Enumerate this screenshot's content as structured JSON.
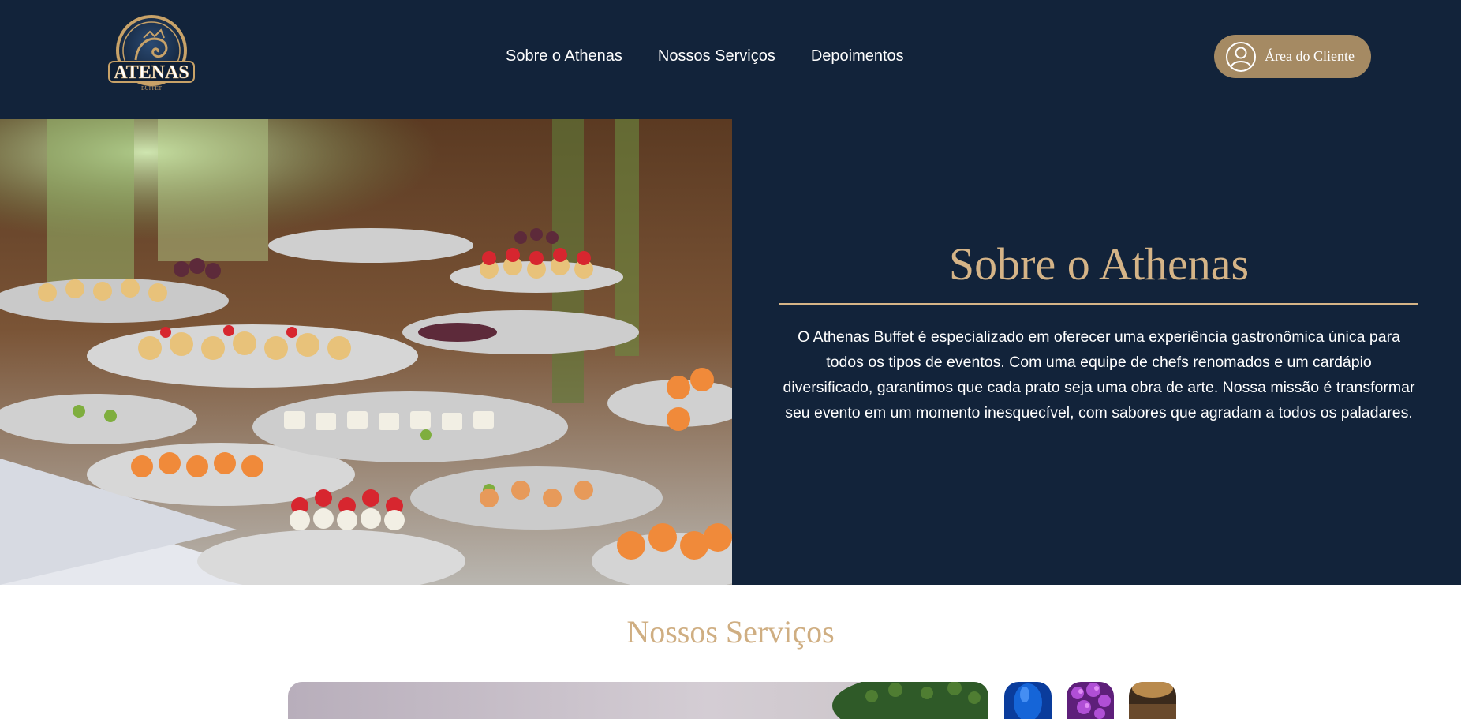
{
  "header": {
    "logo_alt": "Atenas Buffet",
    "logo_text": "ATENAS",
    "logo_subtext": "BUFFET",
    "nav": [
      {
        "label": "Sobre o Athenas"
      },
      {
        "label": "Nossos Serviços"
      },
      {
        "label": "Depoimentos"
      }
    ],
    "client_button_label": "Área do Cliente",
    "client_button_icon": "user-circle-icon"
  },
  "about": {
    "title": "Sobre o Athenas",
    "body": "O Athenas Buffet é especializado em oferecer uma experiência gastronômica única para todos os tipos de eventos. Com uma equipe de chefs renomados e um cardápio diversificado, garantimos que cada prato seja uma obra de arte. Nossa missão é transformar seu evento em um momento inesquecível, com sabores que agradam a todos os paladares."
  },
  "services": {
    "title": "Nossos Serviços"
  },
  "colors": {
    "header_bg": "#12233a",
    "accent_gold": "#d5b487",
    "button_bg": "#a58a63"
  }
}
